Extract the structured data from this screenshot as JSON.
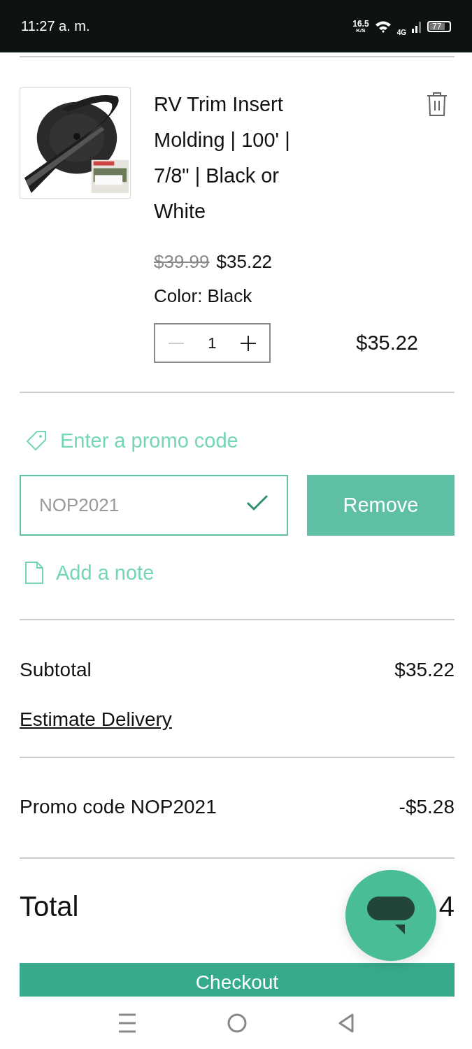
{
  "status_bar": {
    "time": "11:27 a. m.",
    "speed": "16.5",
    "speed_unit": "K/S",
    "network": "4G",
    "battery": "77"
  },
  "item": {
    "title": "RV Trim Insert Molding | 100' | 7/8\" | Black or White",
    "original_price": "$39.99",
    "price": "$35.22",
    "option": "Color: Black",
    "quantity": "1",
    "decrement_disabled": true,
    "line_total": "$35.22"
  },
  "promo": {
    "link": "Enter a promo code",
    "code": "NOP2021",
    "valid": true,
    "button": "Remove"
  },
  "note_link": "Add a note",
  "summary": {
    "subtotal": {
      "label": "Subtotal",
      "value": "$35.22"
    },
    "estimate": "Estimate Delivery",
    "discount": {
      "label": "Promo code NOP2021",
      "value": "-$5.28"
    },
    "total": {
      "label": "Total",
      "value": "4"
    }
  },
  "checkout": "Checkout"
}
